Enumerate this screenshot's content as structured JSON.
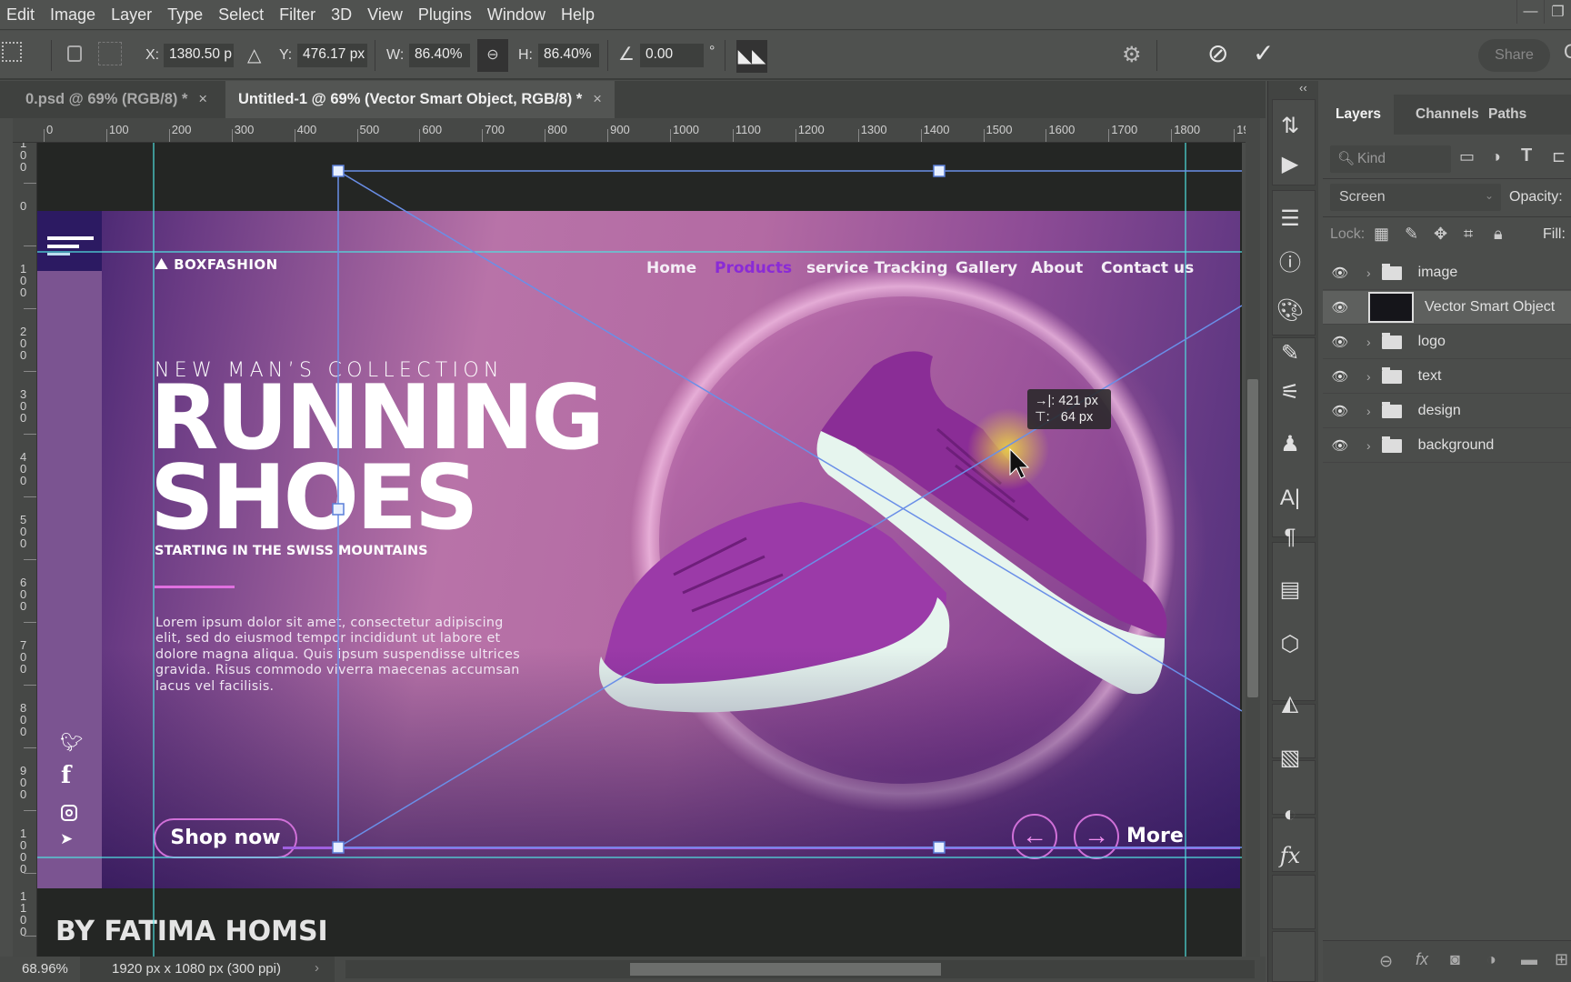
{
  "menu": [
    "Edit",
    "Image",
    "Layer",
    "Type",
    "Select",
    "Filter",
    "3D",
    "View",
    "Plugins",
    "Window",
    "Help"
  ],
  "options": {
    "x_label": "X:",
    "x_value": "1380.50 p",
    "y_label": "Y:",
    "y_value": "476.17 px",
    "w_label": "W:",
    "w_value": "86.40%",
    "h_label": "H:",
    "h_value": "86.40%",
    "angle_value": "0.00",
    "degree": "°",
    "share": "Share"
  },
  "tabs": [
    {
      "label": "0.psd @ 69% (RGB/8) *",
      "active": false
    },
    {
      "label": "Untitled-1 @ 69% (Vector Smart Object, RGB/8) *",
      "active": true
    }
  ],
  "close_glyph": "×",
  "ruler_h": [
    "0",
    "100",
    "200",
    "300",
    "400",
    "500",
    "600",
    "700",
    "800",
    "900",
    "1000",
    "1100",
    "1200",
    "1300",
    "1400",
    "1500",
    "1600",
    "1700",
    "1800",
    "19"
  ],
  "ruler_v": [
    "1 0 0",
    "0",
    "1 0 0",
    "2 0 0",
    "3 0 0",
    "4 0 0",
    "5 0 0",
    "6 0 0",
    "7 0 0",
    "8 0 0",
    "9 0 0",
    "1 0 0 0",
    "1 1 0 0"
  ],
  "design": {
    "brand": "BOXFASHION",
    "nav": [
      {
        "label": "Home",
        "active": false
      },
      {
        "label": "Products",
        "active": true
      },
      {
        "label": "service Tracking",
        "active": false
      },
      {
        "label": "Gallery",
        "active": false
      },
      {
        "label": "About",
        "active": false
      },
      {
        "label": "Contact us",
        "active": false
      }
    ],
    "eyebrow": "NEW MAN’S COLLECTION",
    "title1": "RUNNING",
    "title2": "SHOES",
    "subtitle": "STARTING IN THE SWISS MOUNTAINS",
    "body": [
      "Lorem ipsum dolor sit amet, consectetur adipiscing",
      "elit, sed do eiusmod tempor incididunt ut labore et",
      "dolore magna aliqua. Quis ipsum suspendisse ultrices",
      "gravida. Risus commodo viverra maecenas accumsan",
      "lacus vel facilisis."
    ],
    "cta": "Shop now",
    "more": "More",
    "accent": "#8a2bd6",
    "credit": "BY FATIMA HOMSI"
  },
  "tooltip": {
    "h_glyph": "→|:",
    "h_value": "421 px",
    "v_glyph": "⊤:",
    "v_value": "64 px"
  },
  "status": {
    "zoom": "68.96%",
    "doc": "1920 px x 1080 px (300 ppi)"
  },
  "layers_panel": {
    "tabs": [
      "Layers",
      "Channels",
      "Paths"
    ],
    "filter_placeholder": "Kind",
    "blend_mode": "Screen",
    "opacity_label": "Opacity:",
    "lock_label": "Lock:",
    "fill_label": "Fill:",
    "layers": [
      {
        "name": "image",
        "type": "group"
      },
      {
        "name": "Vector Smart Object",
        "type": "smart-object",
        "selected": true
      },
      {
        "name": "logo",
        "type": "group"
      },
      {
        "name": "text",
        "type": "group"
      },
      {
        "name": "design",
        "type": "group"
      },
      {
        "name": "background",
        "type": "group"
      }
    ]
  }
}
